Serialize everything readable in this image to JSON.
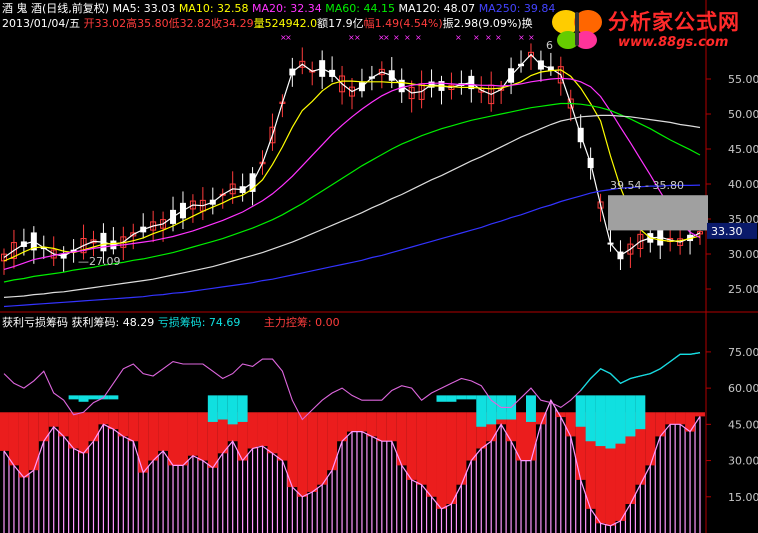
{
  "header": {
    "stock_name": "酒 鬼 酒",
    "period": "(日线,前复权)",
    "ma5": "MA5: 33.03",
    "ma10": "MA10: 32.58",
    "ma20": "MA20: 32.34",
    "ma60": "MA60: 44.15",
    "ma120": "MA120: 48.07",
    "ma250": "MA250: 39.84",
    "date": "2013/01/04/五",
    "open": "开33.02",
    "high": "高35.80",
    "low": "低32.82",
    "close": "收34.29",
    "volume": "量524942.0",
    "amount": "额17.9亿",
    "change": "幅1.49(4.54%)",
    "amplitude": "振2.98(9.09%)",
    "tail": "换"
  },
  "logo": {
    "title": "分析家公式网",
    "url": "www.88gs.com"
  },
  "indicator_header": {
    "name": "获利亏损筹码",
    "profit": "获利筹码: 48.29",
    "loss": "亏损筹码: 74.69",
    "control": "主力控筹: 0.00"
  },
  "annotations": {
    "low_marker": "27.09",
    "high_marker": "6",
    "range_label": "39.54 - 35.80",
    "price_tag": "33.30"
  },
  "colors": {
    "up": "#ff3c3c",
    "down": "#ffffff",
    "ma5": "#ffffff",
    "ma10": "#ffff00",
    "ma20": "#ff33ff",
    "ma60": "#00ee00",
    "ma120": "#dddddd",
    "ma250": "#3333ff",
    "profit": "#ff2020",
    "loss": "#10e0e0",
    "chip_line": "#ff99ff",
    "accent_red": "#ff3c3c"
  },
  "chart_data": [
    {
      "type": "line",
      "title": "酒鬼酒 (日线,前复权)",
      "ylim": [
        22,
        62
      ],
      "y_ticks": [
        25.0,
        30.0,
        35.0,
        40.0,
        45.0,
        50.0,
        55.0
      ],
      "series": [
        {
          "name": "MA5",
          "values": [
            29.5,
            30.5,
            31.4,
            31.8,
            30.9,
            30.0,
            29.7,
            30.5,
            31.2,
            31.8,
            31.7,
            31.3,
            31.7,
            32.8,
            33.5,
            34.0,
            34.3,
            35.3,
            36.2,
            37.0,
            36.9,
            37.4,
            38.5,
            39.3,
            39.2,
            40.2,
            43.0,
            47.0,
            51.6,
            56.0,
            57.1,
            56.1,
            56.5,
            55.8,
            54.3,
            53.2,
            53.9,
            55.2,
            56.0,
            55.5,
            54.0,
            53.0,
            53.2,
            54.2,
            54.0,
            53.8,
            54.2,
            54.5,
            53.4,
            52.8,
            53.5,
            55.5,
            57.0,
            58.5,
            57.0,
            56.5,
            55.6,
            51.5,
            47.0,
            43.0,
            37.0,
            31.5,
            29.8,
            30.7,
            31.8,
            32.3,
            32.4,
            32.0,
            31.7,
            32.3,
            33.03
          ]
        },
        {
          "name": "MA10",
          "values": [
            29.0,
            29.6,
            30.3,
            30.9,
            31.0,
            30.8,
            30.4,
            30.2,
            30.6,
            31.0,
            31.4,
            31.5,
            31.6,
            31.9,
            32.3,
            32.9,
            33.4,
            34.0,
            34.7,
            35.4,
            36.1,
            36.7,
            37.3,
            38.0,
            38.4,
            39.3,
            40.6,
            42.8,
            45.3,
            48.1,
            50.5,
            51.8,
            53.3,
            54.3,
            54.7,
            54.7,
            54.6,
            54.6,
            54.6,
            54.5,
            54.5,
            54.3,
            54.1,
            54.0,
            54.0,
            53.9,
            53.8,
            53.8,
            53.7,
            53.6,
            53.7,
            54.1,
            54.6,
            55.5,
            56.0,
            56.2,
            56.3,
            55.4,
            53.7,
            51.5,
            49.0,
            44.0,
            39.5,
            36.0,
            33.5,
            32.3,
            32.0,
            31.8,
            31.9,
            32.2,
            32.58
          ]
        },
        {
          "name": "MA20",
          "values": [
            27.8,
            28.2,
            28.7,
            29.2,
            29.5,
            29.8,
            30.1,
            30.3,
            30.5,
            30.8,
            31.0,
            31.2,
            31.3,
            31.5,
            31.7,
            31.9,
            32.2,
            32.5,
            32.9,
            33.3,
            33.8,
            34.3,
            34.8,
            35.4,
            36.0,
            36.8,
            37.6,
            38.6,
            39.8,
            41.1,
            42.6,
            44.1,
            45.6,
            47.1,
            48.4,
            49.6,
            50.7,
            51.7,
            52.6,
            53.3,
            53.8,
            54.1,
            54.3,
            54.4,
            54.4,
            54.3,
            54.2,
            54.2,
            54.1,
            54.1,
            54.0,
            54.1,
            54.3,
            54.6,
            54.8,
            55.0,
            55.1,
            55.0,
            54.6,
            53.9,
            52.5,
            50.4,
            48.1,
            45.9,
            43.6,
            41.3,
            38.9,
            36.6,
            34.6,
            33.1,
            32.34
          ]
        },
        {
          "name": "MA60",
          "values": [
            26.0,
            26.3,
            26.5,
            26.8,
            27.0,
            27.2,
            27.4,
            27.7,
            27.9,
            28.1,
            28.4,
            28.6,
            28.8,
            29.1,
            29.3,
            29.6,
            29.9,
            30.2,
            30.6,
            31.0,
            31.4,
            31.8,
            32.2,
            32.7,
            33.2,
            33.7,
            34.3,
            34.9,
            35.6,
            36.4,
            37.2,
            38.1,
            39.0,
            39.9,
            40.8,
            41.7,
            42.6,
            43.4,
            44.2,
            45.0,
            45.7,
            46.3,
            46.9,
            47.4,
            47.9,
            48.3,
            48.7,
            49.1,
            49.4,
            49.7,
            50.0,
            50.3,
            50.6,
            50.9,
            51.1,
            51.3,
            51.5,
            51.5,
            51.4,
            51.2,
            50.9,
            50.5,
            49.9,
            49.3,
            48.6,
            47.9,
            47.1,
            46.3,
            45.6,
            44.9,
            44.15
          ]
        },
        {
          "name": "MA120",
          "values": [
            23.8,
            23.9,
            24.0,
            24.2,
            24.3,
            24.5,
            24.6,
            24.8,
            25.0,
            25.2,
            25.4,
            25.6,
            25.8,
            26.0,
            26.2,
            26.4,
            26.7,
            27.0,
            27.3,
            27.6,
            27.9,
            28.2,
            28.6,
            29.0,
            29.4,
            29.8,
            30.2,
            30.7,
            31.2,
            31.7,
            32.3,
            32.9,
            33.5,
            34.1,
            34.7,
            35.3,
            35.9,
            36.6,
            37.2,
            37.9,
            38.5,
            39.2,
            39.9,
            40.6,
            41.2,
            41.9,
            42.6,
            43.3,
            43.9,
            44.6,
            45.3,
            46.0,
            46.7,
            47.3,
            47.9,
            48.5,
            49.0,
            49.3,
            49.6,
            49.7,
            49.8,
            49.8,
            49.7,
            49.6,
            49.4,
            49.2,
            49.0,
            48.8,
            48.5,
            48.3,
            48.07
          ]
        },
        {
          "name": "MA250",
          "values": [
            22.5,
            22.6,
            22.7,
            22.8,
            22.9,
            23.0,
            23.1,
            23.2,
            23.3,
            23.4,
            23.5,
            23.6,
            23.7,
            23.8,
            23.9,
            24.1,
            24.2,
            24.4,
            24.5,
            24.7,
            24.9,
            25.1,
            25.3,
            25.5,
            25.7,
            25.9,
            26.2,
            26.4,
            26.7,
            27.0,
            27.3,
            27.6,
            27.9,
            28.2,
            28.5,
            28.8,
            29.1,
            29.5,
            29.8,
            30.2,
            30.6,
            31.0,
            31.4,
            31.8,
            32.2,
            32.6,
            33.0,
            33.4,
            33.8,
            34.3,
            34.7,
            35.2,
            35.6,
            36.1,
            36.6,
            37.0,
            37.5,
            37.9,
            38.3,
            38.7,
            39.0,
            39.2,
            39.4,
            39.5,
            39.6,
            39.7,
            39.7,
            39.8,
            39.8,
            39.8,
            39.84
          ]
        }
      ]
    },
    {
      "type": "bar",
      "title": "获利亏损筹码",
      "ylim": [
        0,
        82
      ],
      "y_ticks": [
        15.0,
        30.0,
        45.0,
        60.0,
        75.0
      ],
      "series": [
        {
          "name": "获利筹码",
          "values": [
            34,
            28,
            23,
            26,
            38,
            44,
            40,
            35,
            33,
            38,
            45,
            43,
            40,
            38,
            25,
            30,
            34,
            28,
            28,
            32,
            30,
            27,
            33,
            38,
            30,
            35,
            36,
            33,
            30,
            19,
            15,
            17,
            20,
            26,
            38,
            42,
            42,
            40,
            38,
            38,
            28,
            22,
            20,
            15,
            10,
            12,
            20,
            30,
            35,
            38,
            45,
            38,
            30,
            30,
            45,
            55,
            48,
            40,
            22,
            10,
            4,
            3,
            5,
            12,
            20,
            28,
            40,
            45,
            45,
            42,
            48.29
          ]
        },
        {
          "name": "亏损筹码",
          "values": [
            66,
            62,
            60,
            63,
            67,
            58,
            55,
            49,
            50,
            54,
            56,
            62,
            68,
            70,
            66,
            65,
            68,
            71,
            70,
            70,
            70,
            67,
            64,
            66,
            70,
            69,
            72,
            72,
            67,
            55,
            47,
            51,
            55,
            58,
            60,
            57,
            55,
            55,
            55,
            59,
            61,
            60,
            55,
            58,
            60,
            62,
            64,
            63,
            61,
            55,
            52,
            52,
            56,
            60,
            55,
            54,
            52,
            55,
            59,
            64,
            68,
            66,
            62,
            64,
            65,
            66,
            68,
            71,
            74,
            74,
            74.69
          ]
        }
      ]
    }
  ]
}
